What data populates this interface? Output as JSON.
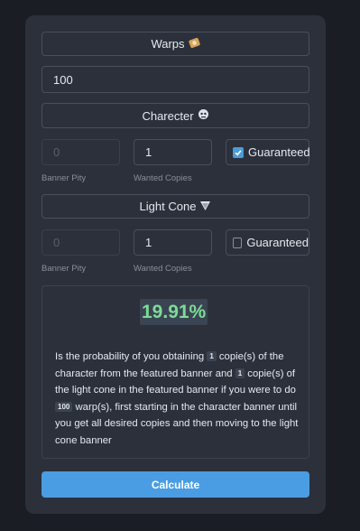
{
  "warps": {
    "header": "Warps",
    "value": "100"
  },
  "character": {
    "header": "Charecter",
    "pity_placeholder": "0",
    "wanted_copies": "1",
    "guaranteed_label": "Guaranteed",
    "guaranteed": true,
    "pity_caption": "Banner Pity",
    "wanted_caption": "Wanted Copies"
  },
  "light_cone": {
    "header": "Light Cone",
    "pity_placeholder": "0",
    "wanted_copies": "1",
    "guaranteed_label": "Guaranteed",
    "guaranteed": false,
    "pity_caption": "Banner Pity",
    "wanted_caption": "Wanted Copies"
  },
  "result": {
    "percent": "19.91%",
    "text_1": "Is the probability of you obtaining",
    "char_copies": "1",
    "text_2": "copie(s) of the character from the featured banner and",
    "cone_copies": "1",
    "text_3": "copie(s) of the light cone in the featured banner if you were to do",
    "warps": "100",
    "text_4": "warp(s), first starting in the character banner until you get all desired copies and then moving to the light cone banner"
  },
  "calculate_label": "Calculate",
  "colors": {
    "accent": "#4a9de3",
    "success": "#7ddc97",
    "card": "#2b303b",
    "background": "#1a1d23"
  }
}
